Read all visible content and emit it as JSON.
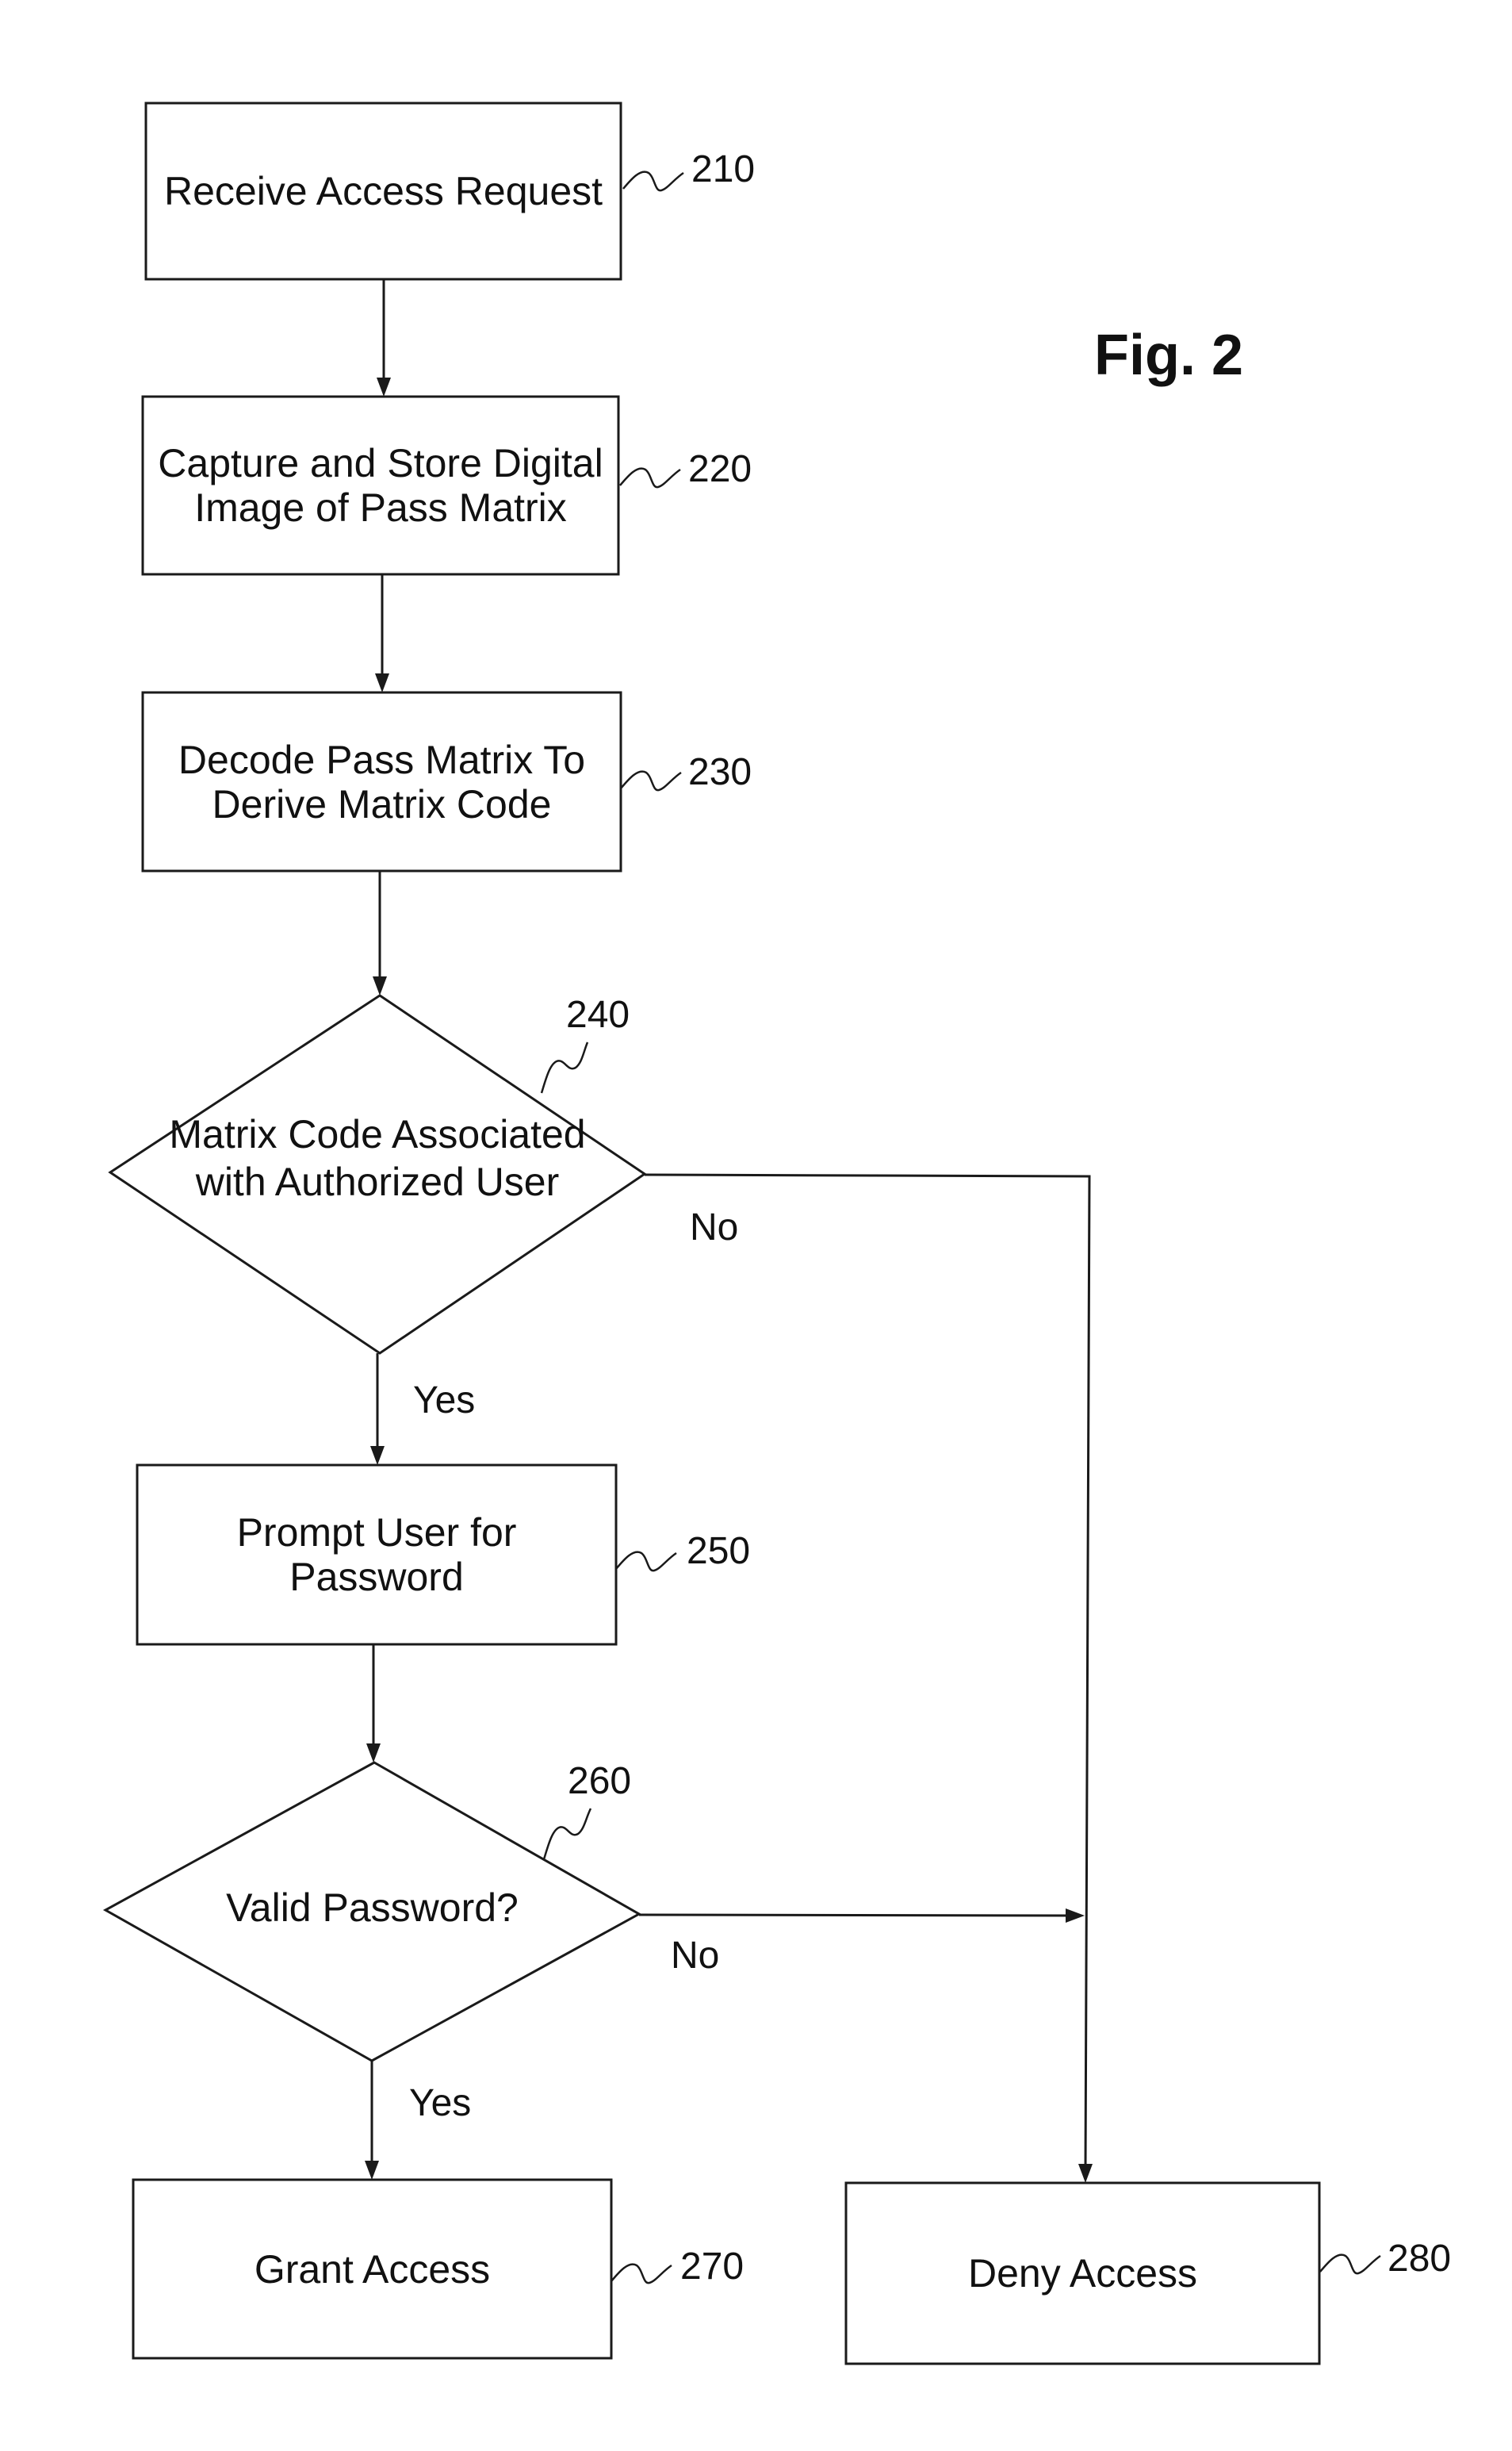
{
  "figure": {
    "title": "Fig. 2"
  },
  "nodes": {
    "n210": {
      "ref": "210",
      "type": "process",
      "lines": [
        "Receive Access Request"
      ]
    },
    "n220": {
      "ref": "220",
      "type": "process",
      "lines": [
        "Capture and Store Digital",
        "Image of Pass Matrix"
      ]
    },
    "n230": {
      "ref": "230",
      "type": "process",
      "lines": [
        "Decode Pass Matrix To",
        "Derive Matrix Code"
      ]
    },
    "n240": {
      "ref": "240",
      "type": "decision",
      "lines": [
        "Matrix Code Associated",
        "with Authorized User"
      ]
    },
    "n250": {
      "ref": "250",
      "type": "process",
      "lines": [
        "Prompt User for",
        "Password"
      ]
    },
    "n260": {
      "ref": "260",
      "type": "decision",
      "lines": [
        "Valid Password?"
      ]
    },
    "n270": {
      "ref": "270",
      "type": "process",
      "lines": [
        "Grant Access"
      ]
    },
    "n280": {
      "ref": "280",
      "type": "process",
      "lines": [
        "Deny Access"
      ]
    }
  },
  "edges": [
    {
      "from": "210",
      "to": "220",
      "label": ""
    },
    {
      "from": "220",
      "to": "230",
      "label": ""
    },
    {
      "from": "230",
      "to": "240",
      "label": ""
    },
    {
      "from": "240",
      "to": "250",
      "label": "Yes"
    },
    {
      "from": "240",
      "to": "280",
      "label": "No"
    },
    {
      "from": "250",
      "to": "260",
      "label": ""
    },
    {
      "from": "260",
      "to": "270",
      "label": "Yes"
    },
    {
      "from": "260",
      "to": "280",
      "label": "No"
    }
  ],
  "branch_labels": {
    "d240_yes": "Yes",
    "d240_no": "No",
    "d260_yes": "Yes",
    "d260_no": "No"
  }
}
